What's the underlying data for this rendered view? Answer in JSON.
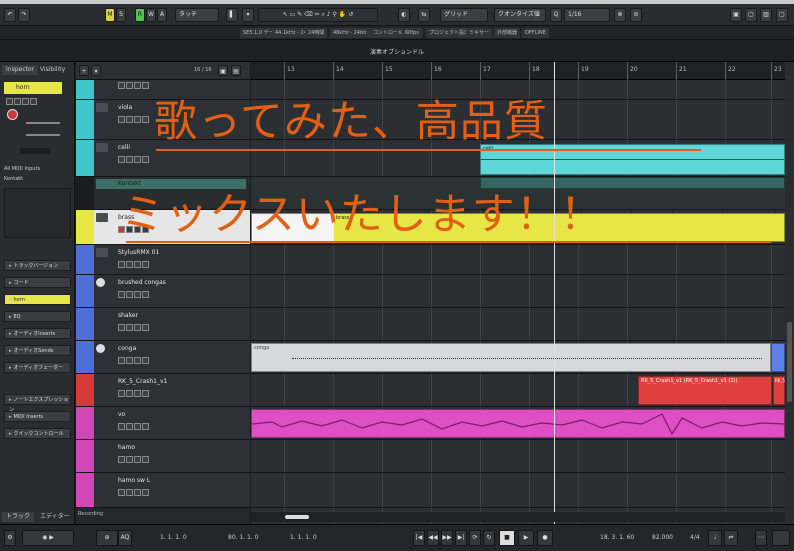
{
  "toolbar": {
    "buttons": [
      "M",
      "S",
      "R",
      "W",
      "A"
    ],
    "mode": "タッチ",
    "grid": "グリッド",
    "quantize_mode": "クオンタイズ値",
    "quantize": "1/16",
    "accent": "#d8d040"
  },
  "info_line": {
    "items": [
      "SE5.1,0 データ",
      "44.1kHz - 24bit",
      "24時間",
      "48kHz - 24bit",
      "コントロール",
      "60fps",
      "プロジェクト設定",
      "ミキサー",
      "外部機器",
      "OFFLINE"
    ]
  },
  "project_title": "演奏オプションドル",
  "inspector": {
    "tab_inspector": "Inspector",
    "tab_visibility": "Visibility",
    "track_name": "horn",
    "sections": [
      "トラックバージョン",
      "コード",
      "horn",
      "EQ",
      "オーディオInserts",
      "オーディオSends",
      "オーディオフェーダー",
      "ノートエクスプレッション",
      "MIDI Inserts",
      "クイックコントロール"
    ],
    "input_label": "All MIDI Inputs",
    "output_label": "Kontakt",
    "bottom_tab_left": "トラック",
    "bottom_tab_right": "エディター"
  },
  "header_counter": "16 / 16",
  "tracks": [
    {
      "name": "",
      "color": "#3fc6c9",
      "type": "audio"
    },
    {
      "name": "viola",
      "color": "#3fc6c9",
      "type": "midi"
    },
    {
      "name": "celli",
      "color": "#3fc6c9",
      "type": "midi"
    },
    {
      "name": "Kontakt",
      "color": "#3b6f68",
      "type": "sub"
    },
    {
      "name": "brass",
      "color": "#e6e646",
      "type": "midi"
    },
    {
      "name": "StylusRMX 01",
      "color": "#4e6fd6",
      "type": "inst"
    },
    {
      "name": "brushed congas",
      "color": "#4e6fd6",
      "type": "audio"
    },
    {
      "name": "shaker",
      "color": "#4e6fd6",
      "type": "audio"
    },
    {
      "name": "conga",
      "color": "#4e6fd6",
      "type": "audio"
    },
    {
      "name": "RK_5_Crash1_v1",
      "color": "#d43a3a",
      "type": "audio"
    },
    {
      "name": "vo",
      "color": "#d347b4",
      "type": "audio"
    },
    {
      "name": "hamo",
      "color": "#d347b4",
      "type": "audio"
    },
    {
      "name": "hamo sw L",
      "color": "#d347b4",
      "type": "audio"
    }
  ],
  "ruler": {
    "bars": [
      "13",
      "14",
      "15",
      "16",
      "17",
      "18",
      "19",
      "20",
      "21",
      "22",
      "23"
    ]
  },
  "clips": {
    "celli": "celli",
    "brass": "brass",
    "conga": "conga",
    "crash": "RK_5_Crash1_v1 (RK_5_Crash1_v1 (2))",
    "crash_end": "RK_5"
  },
  "overlay": {
    "line1": "歌ってみた、高品質",
    "line2": "ミックスいたします！！",
    "color": "#e35f14"
  },
  "transport": {
    "left_locator": "1. 1. 1. 0",
    "right_locator": "80. 1. 1. 0",
    "punch": "1. 1. 1. 0",
    "position": "18. 3. 1. 60",
    "tempo": "82.000",
    "signature": "4/4",
    "mode_label": "AQ",
    "bottom_label": "Recording"
  }
}
